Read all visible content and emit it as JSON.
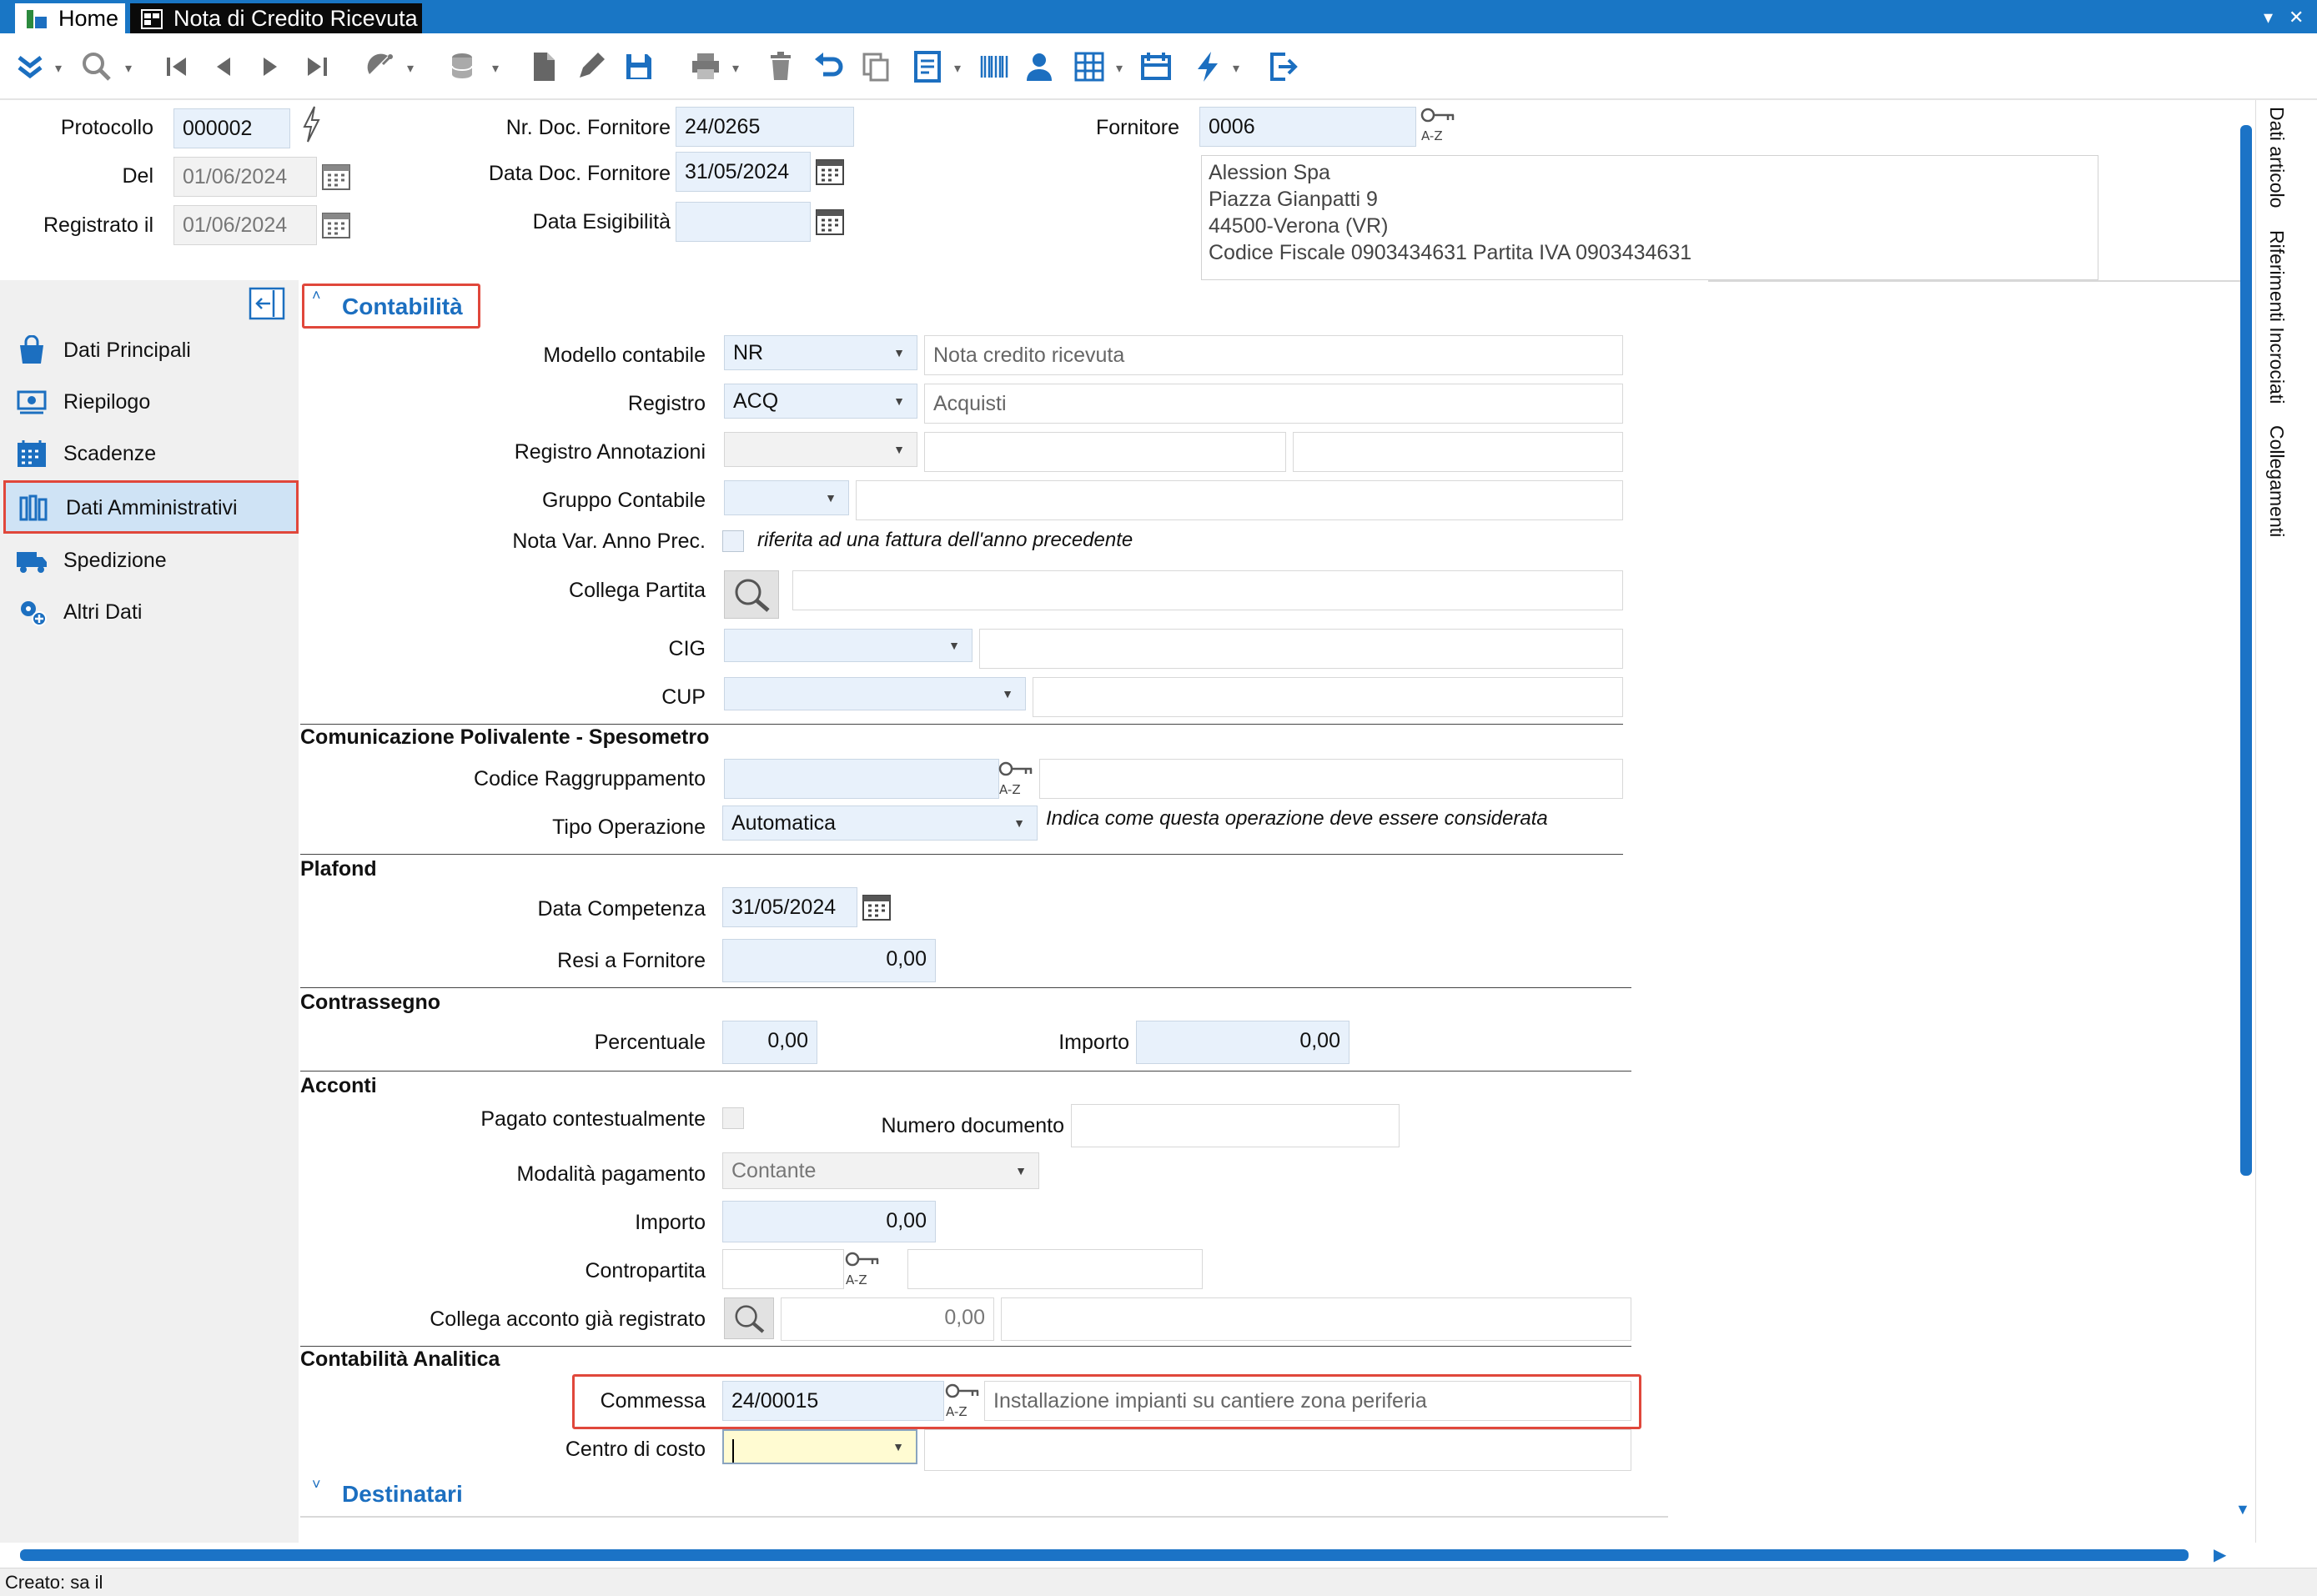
{
  "tabs": {
    "home": "Home",
    "document": "Nota di Credito Ricevuta"
  },
  "header": {
    "protocollo_label": "Protocollo",
    "protocollo_value": "000002",
    "del_label": "Del",
    "del_value": "01/06/2024",
    "registrato_label": "Registrato il",
    "registrato_value": "01/06/2024",
    "nr_doc_label": "Nr. Doc. Fornitore",
    "nr_doc_value": "24/0265",
    "data_doc_label": "Data Doc. Fornitore",
    "data_doc_value": "31/05/2024",
    "data_esig_label": "Data Esigibilità",
    "data_esig_value": "",
    "fornitore_label": "Fornitore",
    "fornitore_value": "0006",
    "address": [
      "Alession Spa",
      "Piazza Gianpatti 9",
      "44500-Verona (VR)",
      "Codice Fiscale 0903434631 Partita IVA 0903434631"
    ]
  },
  "sidebar": {
    "items": [
      {
        "label": "Dati Principali",
        "icon": "bag-icon"
      },
      {
        "label": "Riepilogo",
        "icon": "money-icon"
      },
      {
        "label": "Scadenze",
        "icon": "calendar-icon"
      },
      {
        "label": "Dati Amministrativi",
        "icon": "books-icon",
        "selected": true
      },
      {
        "label": "Spedizione",
        "icon": "truck-icon"
      },
      {
        "label": "Altri Dati",
        "icon": "settings-add-icon"
      }
    ]
  },
  "contabilita": {
    "title": "Contabilità",
    "modello_label": "Modello contabile",
    "modello_value": "NR",
    "modello_desc": "Nota credito ricevuta",
    "registro_label": "Registro",
    "registro_value": "ACQ",
    "registro_desc": "Acquisti",
    "registro_ann_label": "Registro Annotazioni",
    "gruppo_label": "Gruppo Contabile",
    "nota_var_label": "Nota Var. Anno Prec.",
    "nota_var_desc": "riferita ad una fattura dell'anno precedente",
    "collega_partita_label": "Collega Partita",
    "cig_label": "CIG",
    "cup_label": "CUP"
  },
  "spesometro": {
    "title": "Comunicazione Polivalente - Spesometro",
    "codice_label": "Codice Raggruppamento",
    "tipo_label": "Tipo Operazione",
    "tipo_value": "Automatica",
    "tipo_desc": "Indica come questa operazione deve essere considerata"
  },
  "plafond": {
    "title": "Plafond",
    "data_label": "Data Competenza",
    "data_value": "31/05/2024",
    "resi_label": "Resi a Fornitore",
    "resi_value": "0,00"
  },
  "contrassegno": {
    "title": "Contrassegno",
    "perc_label": "Percentuale",
    "perc_value": "0,00",
    "importo_label": "Importo",
    "importo_value": "0,00"
  },
  "acconti": {
    "title": "Acconti",
    "pagato_label": "Pagato contestualmente",
    "numero_label": "Numero documento",
    "modalita_label": "Modalità pagamento",
    "modalita_value": "Contante",
    "importo_label": "Importo",
    "importo_value": "0,00",
    "contropartita_label": "Contropartita",
    "collega_label": "Collega acconto già registrato",
    "collega_value": "0,00"
  },
  "analitica": {
    "title": "Contabilità Analitica",
    "commessa_label": "Commessa",
    "commessa_value": "24/00015",
    "commessa_desc": "Installazione impianti su cantiere zona periferia",
    "centro_label": "Centro di costo"
  },
  "destinatari": {
    "title": "Destinatari"
  },
  "rail": {
    "items": [
      "Dati articolo",
      "Riferimenti Incrociati",
      "Collegamenti"
    ]
  },
  "status": {
    "text": "Creato: sa il"
  },
  "colors": {
    "accent": "#1976c5",
    "highlight": "#e0473b",
    "field": "#e8f1fb"
  }
}
